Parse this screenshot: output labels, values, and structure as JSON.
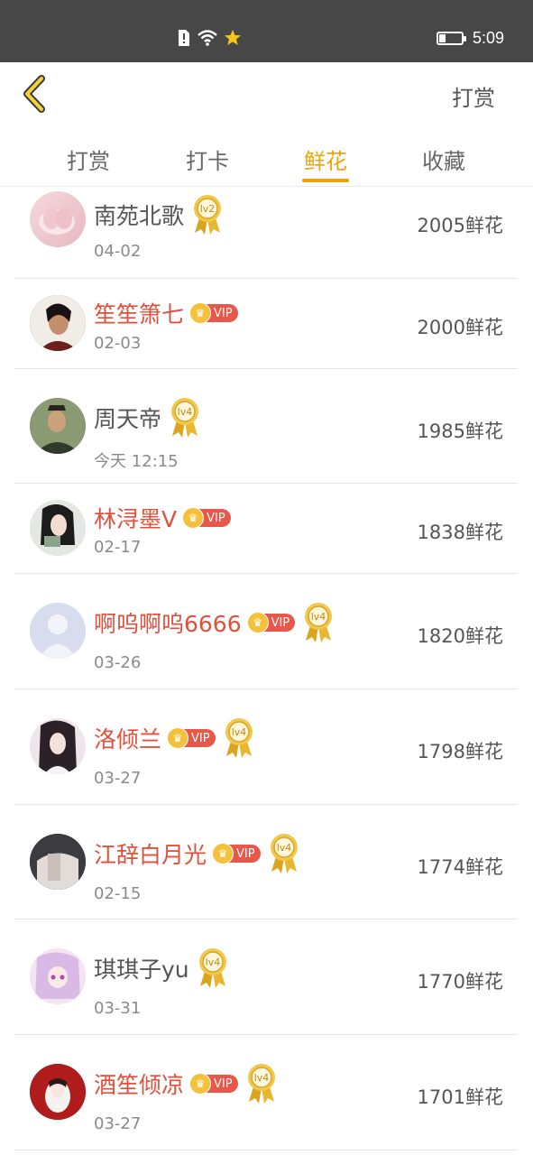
{
  "status_bar": {
    "time": "5:09"
  },
  "header": {
    "back_icon": "chevron-left-icon",
    "action": "打赏"
  },
  "tabs": [
    {
      "label": "打赏",
      "active": false
    },
    {
      "label": "打卡",
      "active": false
    },
    {
      "label": "鲜花",
      "active": true
    },
    {
      "label": "收藏",
      "active": false
    }
  ],
  "vip_label": "VIP",
  "list": [
    {
      "name": "南苑北歌",
      "date": "04-02",
      "amount": "2005鲜花",
      "vip": false,
      "level": "lv2"
    },
    {
      "name": "笙笙箫七",
      "date": "02-03",
      "amount": "2000鲜花",
      "vip": true,
      "level": ""
    },
    {
      "name": "周天帝",
      "date": "今天 12:15",
      "amount": "1985鲜花",
      "vip": false,
      "level": "lv4"
    },
    {
      "name": "林浔墨V",
      "date": "02-17",
      "amount": "1838鲜花",
      "vip": true,
      "level": ""
    },
    {
      "name": "啊呜啊呜6666",
      "date": "03-26",
      "amount": "1820鲜花",
      "vip": true,
      "level": "lv4"
    },
    {
      "name": "洛倾兰",
      "date": "03-27",
      "amount": "1798鲜花",
      "vip": true,
      "level": "lv4"
    },
    {
      "name": "江辞白月光",
      "date": "02-15",
      "amount": "1774鲜花",
      "vip": true,
      "level": "lv4"
    },
    {
      "name": "琪琪子yu",
      "date": "03-31",
      "amount": "1770鲜花",
      "vip": false,
      "level": "lv4"
    },
    {
      "name": "酒笙倾凉",
      "date": "03-27",
      "amount": "1701鲜花",
      "vip": true,
      "level": "lv4"
    }
  ],
  "colors": {
    "accent": "#f0a30a",
    "vip_name": "#e0503a",
    "vip_badge": "#e9564a",
    "status_bar": "#474747"
  }
}
